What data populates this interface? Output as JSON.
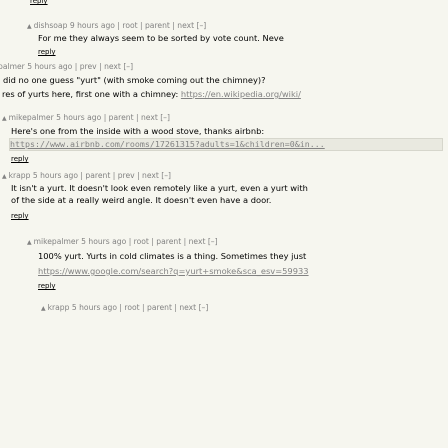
{
  "top_reply": "reply",
  "comments": [
    {
      "user": "dishsoap",
      "age": "9 hours ago",
      "links": [
        "root",
        "parent",
        "next [–]"
      ],
      "text": "For me they always seem to be sorted by vote count. Neve",
      "reply": "reply"
    },
    {
      "user": "palmer",
      "age": "5 hours ago",
      "links": [
        "prev",
        "next [–]"
      ],
      "text_lines": [
        "did no one guess \"yurt\" (with smoke coming out the chimney)?",
        "res of yurts here, first one with a chimney: "
      ],
      "link_text": "https://en.wikipedia.org/wiki/"
    },
    {
      "user": "mikepalmer",
      "age": "5 hours ago",
      "links": [
        "parent",
        "next [–]"
      ],
      "text": "Here's one from the inside with a wood stove, thanks airbnb:",
      "code_link": "https://www.airbnb.com/rooms/17261315?adults=1&children=0&in...",
      "reply": "reply"
    },
    {
      "user": "krapp",
      "age": "5 hours ago",
      "links": [
        "parent",
        "prev",
        "next [–]"
      ],
      "text_lines": [
        "It isn't a yurt. It doesn't look even remotely like a yurt, even a yurt with",
        "of the side at a really weird angle. It doesn't even have a door."
      ],
      "reply": "reply"
    },
    {
      "user": "mikepalmer",
      "age": "5 hours ago",
      "links": [
        "root",
        "parent",
        "next [–]"
      ],
      "text_lines": [
        "100% yurt. Yurts in cold climates is a thing. Sometimes they just"
      ],
      "link_text": "https://www.google.com/search?q=yurt+smoke&sca_esv=59933",
      "reply": "reply"
    },
    {
      "user": "krapp",
      "age": "5 hours ago",
      "links": [
        "root",
        "parent",
        "next [–]"
      ]
    }
  ]
}
